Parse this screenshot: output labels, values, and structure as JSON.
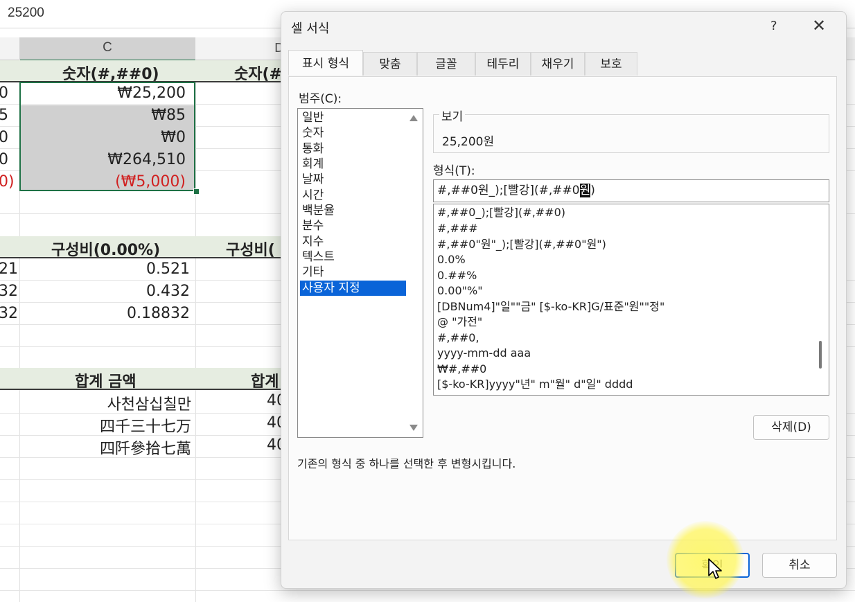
{
  "formula_bar": {
    "value": "25200"
  },
  "sheet": {
    "col_c_header": "C",
    "col_d_header": "D",
    "section1": {
      "header_c": "숫자(#,##0)",
      "header_d": "숫자(#",
      "left_partial": [
        "0",
        "5",
        "0",
        "0",
        "0)"
      ],
      "values": [
        "₩25,200",
        "₩85",
        "₩0",
        "₩264,510",
        "(₩5,000)"
      ]
    },
    "section2": {
      "header_c": "구성비(0.00%)",
      "header_d": "구성비(",
      "left_partial": [
        "21",
        "32",
        "32"
      ],
      "values": [
        "0.521",
        "0.432",
        "0.18832"
      ]
    },
    "section3": {
      "header_c": "합계 금액",
      "header_d": "합계",
      "values": [
        "사천삼십칠만",
        "四千三十七万",
        "四阡參拾七萬"
      ],
      "d_partial": [
        "40",
        "40",
        "40"
      ]
    }
  },
  "dialog": {
    "title": "셀 서식",
    "help": "?",
    "close": "✕",
    "tabs": [
      "표시 형식",
      "맞춤",
      "글꼴",
      "테두리",
      "채우기",
      "보호"
    ],
    "category_label": "범주(C):",
    "categories": [
      "일반",
      "숫자",
      "통화",
      "회계",
      "날짜",
      "시간",
      "백분율",
      "분수",
      "지수",
      "텍스트",
      "기타",
      "사용자 지정"
    ],
    "selected_category": "사용자 지정",
    "sample_label": "보기",
    "sample_value": "25,200원",
    "type_label": "형식(T):",
    "type_input_before": "#,##0원_);[빨강](#,##0",
    "type_input_highlight": "원",
    "type_input_after": ")",
    "format_list": [
      "#,##0_);[빨강](#,##0)",
      "#,###",
      "#,##0\"원\"_);[빨강](#,##0\"원\")",
      "0.0%",
      "0.##%",
      "0.00\"%\"",
      "[DBNum4]\"일\"\"금\" [$-ko-KR]G/표준\"원\"\"정\"",
      "@ \"가전\"",
      "#,##0,",
      "yyyy-mm-dd aaa",
      "₩#,##0",
      "[$-ko-KR]yyyy\"년\" m\"월\" d\"일\" dddd"
    ],
    "delete_button": "삭제(D)",
    "hint": "기존의 형식 중 하나를 선택한 후 변형시킵니다.",
    "ok_button": "확인",
    "cancel_button": "취소"
  },
  "colors": {
    "accent_green": "#1e7145",
    "selection_blue": "#0a64d8",
    "negative_red": "#d02020",
    "highlight_yellow": "#fff550"
  }
}
